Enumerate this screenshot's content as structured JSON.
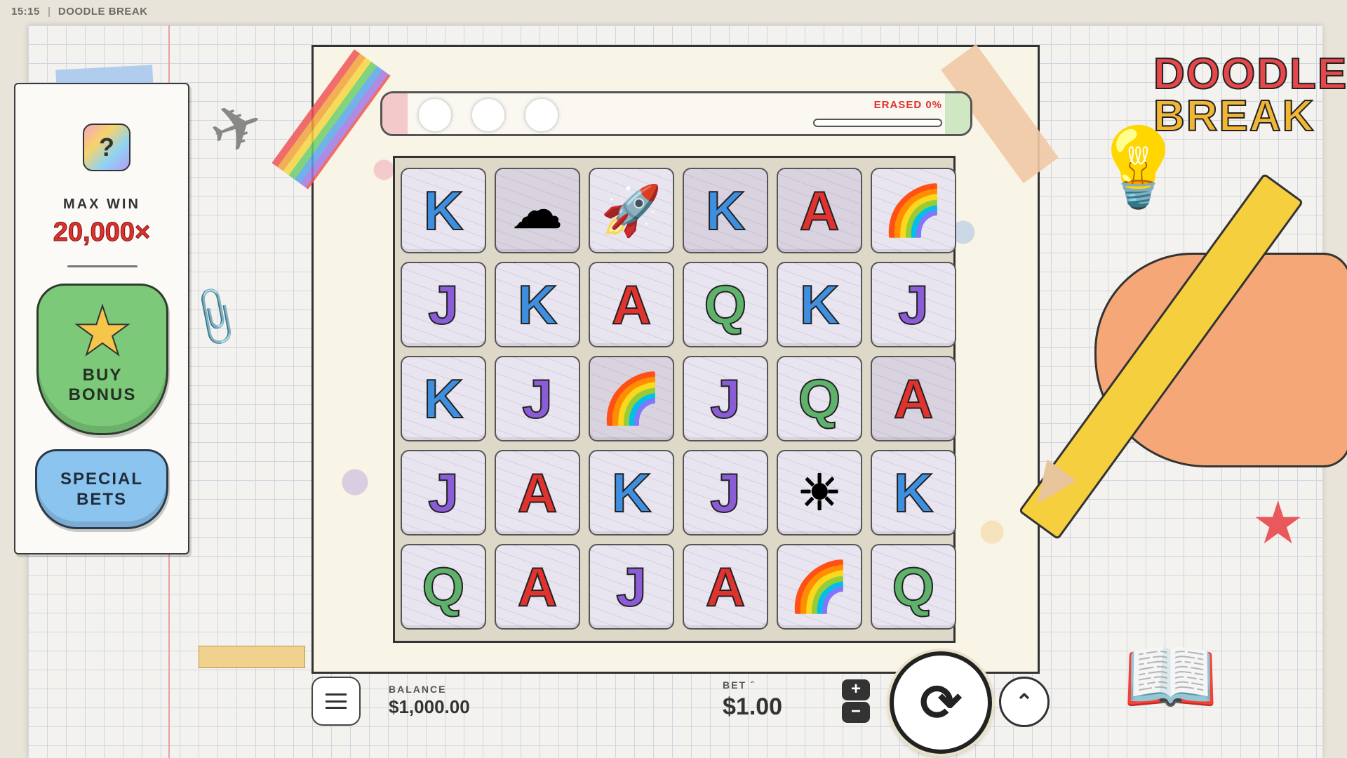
{
  "topbar": {
    "time": "15:15",
    "title": "DOODLE BREAK"
  },
  "left_panel": {
    "help_icon": "?",
    "max_win_label": "MAX WIN",
    "max_win_value": "20,000×",
    "buy_bonus_star": "★",
    "buy_bonus_label_1": "BUY",
    "buy_bonus_label_2": "BONUS",
    "special_bets_label_1": "SPECIAL",
    "special_bets_label_2": "BETS"
  },
  "logo": {
    "line1": "DOODLE",
    "line2": "BREAK"
  },
  "progress": {
    "label": "ERASED 0%",
    "erased_percent": 0
  },
  "colors": {
    "K": "#3f8fe0",
    "J": "#8a5cd6",
    "A": "#e0322e",
    "Q": "#5fb26b",
    "accent_red": "#e0312d",
    "buy_bonus_green": "#7cc97a",
    "special_bets_blue": "#8cc4f0"
  },
  "grid": {
    "rows": [
      [
        {
          "sym": "K"
        },
        {
          "sym": "cloud-icon",
          "glyph": "☁",
          "dark": true
        },
        {
          "sym": "rocket-icon",
          "glyph": "🚀"
        },
        {
          "sym": "K",
          "dark": true
        },
        {
          "sym": "A",
          "dark": true
        },
        {
          "sym": "rainbow-icon",
          "glyph": "🌈"
        }
      ],
      [
        {
          "sym": "J"
        },
        {
          "sym": "K"
        },
        {
          "sym": "A"
        },
        {
          "sym": "Q"
        },
        {
          "sym": "K"
        },
        {
          "sym": "J"
        }
      ],
      [
        {
          "sym": "K"
        },
        {
          "sym": "J"
        },
        {
          "sym": "rainbow-icon",
          "glyph": "🌈",
          "dark": true
        },
        {
          "sym": "J"
        },
        {
          "sym": "Q"
        },
        {
          "sym": "A",
          "dark": true
        }
      ],
      [
        {
          "sym": "J"
        },
        {
          "sym": "A"
        },
        {
          "sym": "K"
        },
        {
          "sym": "J"
        },
        {
          "sym": "sun-icon",
          "glyph": "☀"
        },
        {
          "sym": "K"
        }
      ],
      [
        {
          "sym": "Q"
        },
        {
          "sym": "A"
        },
        {
          "sym": "J"
        },
        {
          "sym": "A"
        },
        {
          "sym": "rainbow-icon",
          "glyph": "🌈"
        },
        {
          "sym": "Q"
        }
      ]
    ]
  },
  "controls": {
    "menu_icon": "menu-icon",
    "balance_label": "BALANCE",
    "balance_value": "$1,000.00",
    "bet_label": "BET ˆ",
    "bet_value": "$1.00",
    "bet_plus": "+",
    "bet_minus": "−",
    "spin_glyph": "⟳",
    "autoplay_glyph": "⌃"
  }
}
